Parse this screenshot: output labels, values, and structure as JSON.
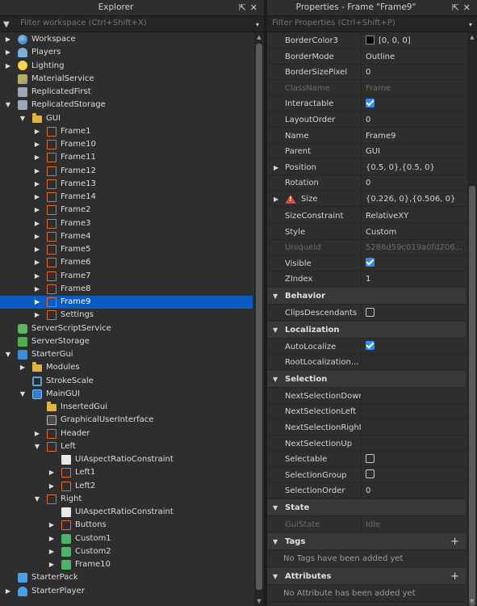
{
  "explorer": {
    "title": "Explorer",
    "filter_placeholder": "Filter workspace (Ctrl+Shift+X)",
    "items": [
      {
        "label": "Workspace",
        "depth": 0,
        "arrow": "closed",
        "icon": "globe"
      },
      {
        "label": "Players",
        "depth": 0,
        "arrow": "closed",
        "icon": "players"
      },
      {
        "label": "Lighting",
        "depth": 0,
        "arrow": "closed",
        "icon": "light"
      },
      {
        "label": "MaterialService",
        "depth": 0,
        "arrow": "none",
        "icon": "mat"
      },
      {
        "label": "ReplicatedFirst",
        "depth": 0,
        "arrow": "none",
        "icon": "grey"
      },
      {
        "label": "ReplicatedStorage",
        "depth": 0,
        "arrow": "open",
        "icon": "grey"
      },
      {
        "label": "GUI",
        "depth": 1,
        "arrow": "open",
        "icon": "folder"
      },
      {
        "label": "Frame1",
        "depth": 2,
        "arrow": "closed",
        "icon": "frame"
      },
      {
        "label": "Frame10",
        "depth": 2,
        "arrow": "closed",
        "icon": "frame"
      },
      {
        "label": "Frame11",
        "depth": 2,
        "arrow": "closed",
        "icon": "frame"
      },
      {
        "label": "Frame12",
        "depth": 2,
        "arrow": "closed",
        "icon": "frame"
      },
      {
        "label": "Frame13",
        "depth": 2,
        "arrow": "closed",
        "icon": "frame"
      },
      {
        "label": "Frame14",
        "depth": 2,
        "arrow": "closed",
        "icon": "frame"
      },
      {
        "label": "Frame2",
        "depth": 2,
        "arrow": "closed",
        "icon": "frame"
      },
      {
        "label": "Frame3",
        "depth": 2,
        "arrow": "closed",
        "icon": "frame"
      },
      {
        "label": "Frame4",
        "depth": 2,
        "arrow": "closed",
        "icon": "frame"
      },
      {
        "label": "Frame5",
        "depth": 2,
        "arrow": "closed",
        "icon": "frame"
      },
      {
        "label": "Frame6",
        "depth": 2,
        "arrow": "closed",
        "icon": "frame"
      },
      {
        "label": "Frame7",
        "depth": 2,
        "arrow": "closed",
        "icon": "frame"
      },
      {
        "label": "Frame8",
        "depth": 2,
        "arrow": "closed",
        "icon": "frame"
      },
      {
        "label": "Frame9",
        "depth": 2,
        "arrow": "closed",
        "icon": "frame",
        "selected": true
      },
      {
        "label": "Settings",
        "depth": 2,
        "arrow": "closed",
        "icon": "frame"
      },
      {
        "label": "ServerScriptService",
        "depth": 0,
        "arrow": "none",
        "icon": "green"
      },
      {
        "label": "ServerStorage",
        "depth": 0,
        "arrow": "none",
        "icon": "green2"
      },
      {
        "label": "StarterGui",
        "depth": 0,
        "arrow": "open",
        "icon": "gui"
      },
      {
        "label": "Modules",
        "depth": 1,
        "arrow": "closed",
        "icon": "folder"
      },
      {
        "label": "StrokeScale",
        "depth": 1,
        "arrow": "none",
        "icon": "stroke"
      },
      {
        "label": "MainGUI",
        "depth": 1,
        "arrow": "open",
        "icon": "screen"
      },
      {
        "label": "InsertedGui",
        "depth": 2,
        "arrow": "none",
        "icon": "folder"
      },
      {
        "label": "GraphicalUserInterface",
        "depth": 2,
        "arrow": "none",
        "icon": "img"
      },
      {
        "label": "Header",
        "depth": 2,
        "arrow": "closed",
        "icon": "frame"
      },
      {
        "label": "Left",
        "depth": 2,
        "arrow": "open",
        "icon": "frame"
      },
      {
        "label": "UIAspectRatioConstraint",
        "depth": 3,
        "arrow": "none",
        "icon": "white"
      },
      {
        "label": "Left1",
        "depth": 3,
        "arrow": "closed",
        "icon": "frame"
      },
      {
        "label": "Left2",
        "depth": 3,
        "arrow": "closed",
        "icon": "frame"
      },
      {
        "label": "Right",
        "depth": 2,
        "arrow": "open",
        "icon": "frame"
      },
      {
        "label": "UIAspectRatioConstraint",
        "depth": 3,
        "arrow": "none",
        "icon": "white"
      },
      {
        "label": "Buttons",
        "depth": 3,
        "arrow": "closed",
        "icon": "frame"
      },
      {
        "label": "Custom1",
        "depth": 3,
        "arrow": "closed",
        "icon": "image"
      },
      {
        "label": "Custom2",
        "depth": 3,
        "arrow": "closed",
        "icon": "image"
      },
      {
        "label": "Frame10",
        "depth": 3,
        "arrow": "closed",
        "icon": "image"
      },
      {
        "label": "StarterPack",
        "depth": 0,
        "arrow": "none",
        "icon": "pack"
      },
      {
        "label": "StarterPlayer",
        "depth": 0,
        "arrow": "closed",
        "icon": "player"
      }
    ]
  },
  "properties": {
    "title": "Properties - Frame \"Frame9\"",
    "filter_placeholder": "Filter Properties (Ctrl+Shift+P)",
    "rows": [
      {
        "kind": "prop",
        "name": "BorderColor3",
        "value": "[0, 0, 0]",
        "swatch": "#000000"
      },
      {
        "kind": "prop",
        "name": "BorderMode",
        "value": "Outline"
      },
      {
        "kind": "prop",
        "name": "BorderSizePixel",
        "value": "0"
      },
      {
        "kind": "prop",
        "name": "ClassName",
        "value": "Frame",
        "dim": true
      },
      {
        "kind": "prop",
        "name": "Interactable",
        "check": true
      },
      {
        "kind": "prop",
        "name": "LayoutOrder",
        "value": "0"
      },
      {
        "kind": "prop",
        "name": "Name",
        "value": "Frame9"
      },
      {
        "kind": "prop",
        "name": "Parent",
        "value": "GUI"
      },
      {
        "kind": "prop",
        "name": "Position",
        "value": "{0.5, 0},{0.5, 0}",
        "expand": true
      },
      {
        "kind": "prop",
        "name": "Rotation",
        "value": "0"
      },
      {
        "kind": "prop",
        "name": "Size",
        "value": "{0.226, 0},{0.506, 0}",
        "expand": true,
        "warn": true
      },
      {
        "kind": "prop",
        "name": "SizeConstraint",
        "value": "RelativeXY"
      },
      {
        "kind": "prop",
        "name": "Style",
        "value": "Custom"
      },
      {
        "kind": "prop",
        "name": "UniqueId",
        "value": "5286d59c019a0fd206...",
        "dim": true
      },
      {
        "kind": "prop",
        "name": "Visible",
        "check": true
      },
      {
        "kind": "prop",
        "name": "ZIndex",
        "value": "1"
      },
      {
        "kind": "section",
        "name": "Behavior"
      },
      {
        "kind": "prop",
        "name": "ClipsDescendants",
        "check": false
      },
      {
        "kind": "section",
        "name": "Localization"
      },
      {
        "kind": "prop",
        "name": "AutoLocalize",
        "check": true
      },
      {
        "kind": "prop",
        "name": "RootLocalization...",
        "value": ""
      },
      {
        "kind": "section",
        "name": "Selection"
      },
      {
        "kind": "prop",
        "name": "NextSelectionDown",
        "value": ""
      },
      {
        "kind": "prop",
        "name": "NextSelectionLeft",
        "value": ""
      },
      {
        "kind": "prop",
        "name": "NextSelectionRight",
        "value": ""
      },
      {
        "kind": "prop",
        "name": "NextSelectionUp",
        "value": ""
      },
      {
        "kind": "prop",
        "name": "Selectable",
        "check": false
      },
      {
        "kind": "prop",
        "name": "SelectionGroup",
        "check": false
      },
      {
        "kind": "prop",
        "name": "SelectionOrder",
        "value": "0"
      },
      {
        "kind": "section",
        "name": "State"
      },
      {
        "kind": "prop",
        "name": "GuiState",
        "value": "Idle",
        "dim": true
      },
      {
        "kind": "section",
        "name": "Tags",
        "plus": true
      },
      {
        "kind": "empty",
        "name": "No Tags have been added yet"
      },
      {
        "kind": "section",
        "name": "Attributes",
        "plus": true
      },
      {
        "kind": "empty",
        "name": "No Attribute has been added yet"
      }
    ]
  },
  "colors": {
    "selection": "#0b5bc4",
    "checkbox": "#2f8ef5",
    "frame_icon": "#e0702f",
    "folder_icon": "#e3b341"
  }
}
